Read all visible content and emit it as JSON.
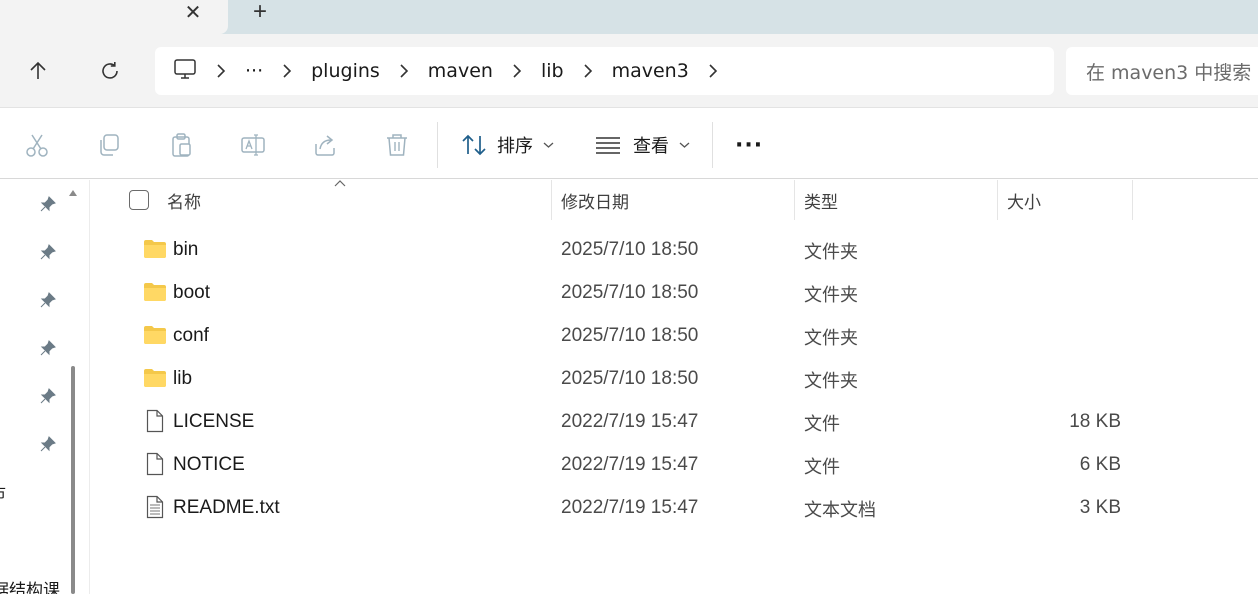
{
  "tabstrip": {
    "close_symbol": "✕",
    "new_tab_symbol": "+"
  },
  "nav": {
    "up_icon": "arrow-up-icon",
    "refresh_icon": "refresh-icon"
  },
  "breadcrumb": {
    "root_icon": "this-pc-icon",
    "overflow": "···",
    "items": [
      "plugins",
      "maven",
      "lib",
      "maven3"
    ]
  },
  "search": {
    "placeholder": "在 maven3 中搜索"
  },
  "commandbar": {
    "icons": [
      "cut-icon",
      "copy-icon",
      "paste-icon",
      "rename-icon",
      "share-icon",
      "delete-icon"
    ],
    "sort_label": "排序",
    "view_label": "查看",
    "more_label": "···"
  },
  "navpane": {
    "fragment_1": "市",
    "fragment_2": "据结构课"
  },
  "columns": {
    "name": "名称",
    "date": "修改日期",
    "type": "类型",
    "size": "大小"
  },
  "files": [
    {
      "name": "bin",
      "date": "2025/7/10 18:50",
      "type": "文件夹",
      "size": "",
      "icon": "folder-icon"
    },
    {
      "name": "boot",
      "date": "2025/7/10 18:50",
      "type": "文件夹",
      "size": "",
      "icon": "folder-icon"
    },
    {
      "name": "conf",
      "date": "2025/7/10 18:50",
      "type": "文件夹",
      "size": "",
      "icon": "folder-icon"
    },
    {
      "name": "lib",
      "date": "2025/7/10 18:50",
      "type": "文件夹",
      "size": "",
      "icon": "folder-icon"
    },
    {
      "name": "LICENSE",
      "date": "2022/7/19 15:47",
      "type": "文件",
      "size": "18 KB",
      "icon": "file-icon"
    },
    {
      "name": "NOTICE",
      "date": "2022/7/19 15:47",
      "type": "文件",
      "size": "6 KB",
      "icon": "file-icon"
    },
    {
      "name": "README.txt",
      "date": "2022/7/19 15:47",
      "type": "文本文档",
      "size": "3 KB",
      "icon": "text-file-icon"
    }
  ],
  "colors": {
    "tabstrip_bg": "#d6e2e6",
    "toolbar_bg": "#f3f3f3",
    "folder_yellow": "#f4c84a"
  }
}
